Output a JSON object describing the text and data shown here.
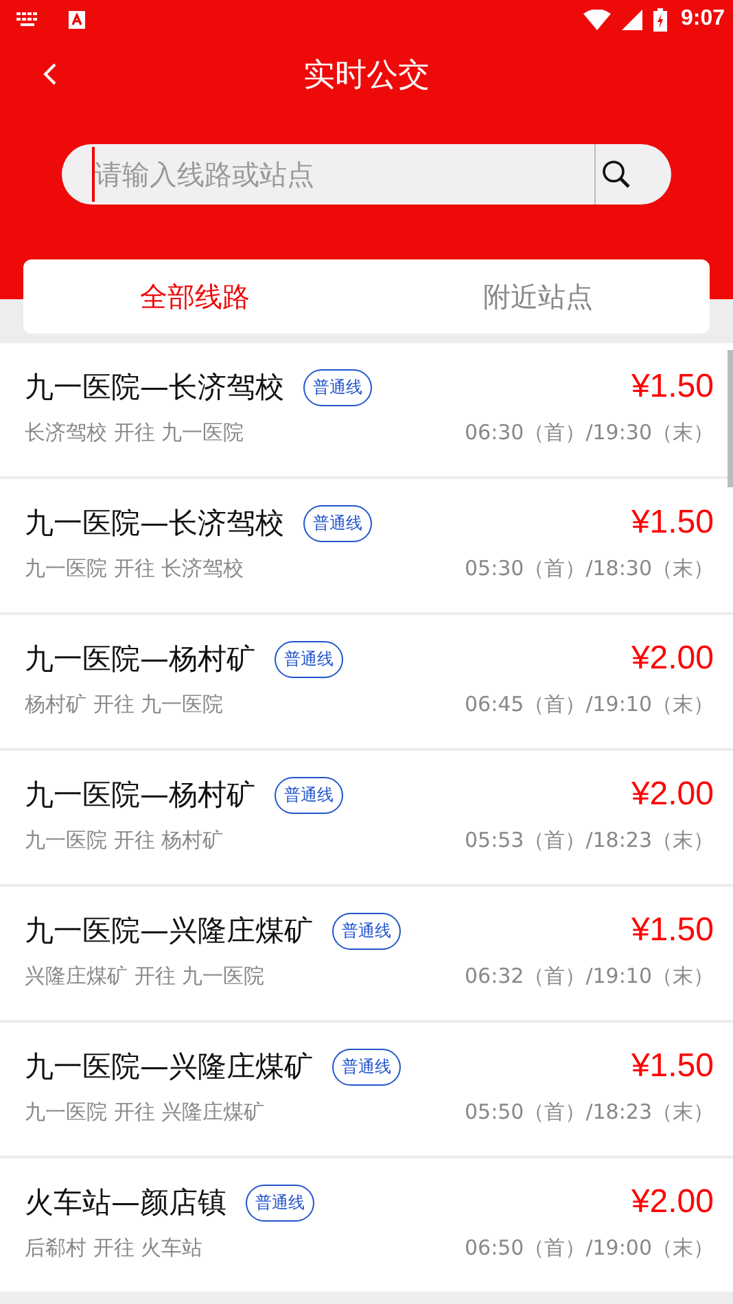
{
  "status_bar": {
    "time": "9:07"
  },
  "header": {
    "title": "实时公交"
  },
  "search": {
    "placeholder": "请输入线路或站点"
  },
  "tabs": [
    {
      "label": "全部线路",
      "selected": true
    },
    {
      "label": "附近站点",
      "selected": false
    }
  ],
  "routes": [
    {
      "name": "九一医院—长济驾校",
      "tag": "普通线",
      "price": "¥1.50",
      "direction": "长济驾校 开往 九一医院",
      "hours": "06:30（首）/19:30（末）"
    },
    {
      "name": "九一医院—长济驾校",
      "tag": "普通线",
      "price": "¥1.50",
      "direction": "九一医院 开往 长济驾校",
      "hours": "05:30（首）/18:30（末）"
    },
    {
      "name": "九一医院—杨村矿",
      "tag": "普通线",
      "price": "¥2.00",
      "direction": "杨村矿 开往 九一医院",
      "hours": "06:45（首）/19:10（末）"
    },
    {
      "name": "九一医院—杨村矿",
      "tag": "普通线",
      "price": "¥2.00",
      "direction": "九一医院 开往 杨村矿",
      "hours": "05:53（首）/18:23（末）"
    },
    {
      "name": "九一医院—兴隆庄煤矿",
      "tag": "普通线",
      "price": "¥1.50",
      "direction": "兴隆庄煤矿 开往 九一医院",
      "hours": "06:32（首）/19:10（末）"
    },
    {
      "name": "九一医院—兴隆庄煤矿",
      "tag": "普通线",
      "price": "¥1.50",
      "direction": "九一医院 开往 兴隆庄煤矿",
      "hours": "05:50（首）/18:23（末）"
    },
    {
      "name": "火车站—颜店镇",
      "tag": "普通线",
      "price": "¥2.00",
      "direction": "后郗村 开往 火车站",
      "hours": "06:50（首）/19:00（末）"
    }
  ]
}
